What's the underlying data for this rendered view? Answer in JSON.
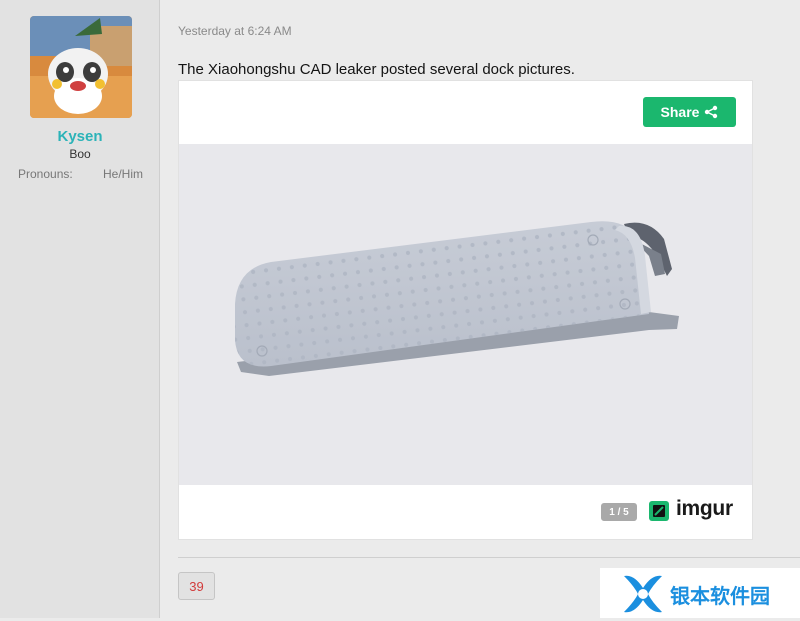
{
  "user": {
    "name": "Kysen",
    "title": "Boo",
    "pronouns_label": "Pronouns:",
    "pronouns_value": "He/Him"
  },
  "post": {
    "timestamp": "Yesterday at 6:24 AM",
    "message": "The Xiaohongshu CAD leaker posted several dock pictures."
  },
  "embed": {
    "share_label": "Share",
    "pager": "1 / 5",
    "brand": "imgur"
  },
  "reactions": {
    "count": "39"
  },
  "watermark": {
    "text": "银本软件园"
  },
  "colors": {
    "username": "#2bb3b8",
    "share_button": "#1bb76e",
    "reaction_count": "#d23c3c",
    "watermark": "#1b8fdf"
  }
}
